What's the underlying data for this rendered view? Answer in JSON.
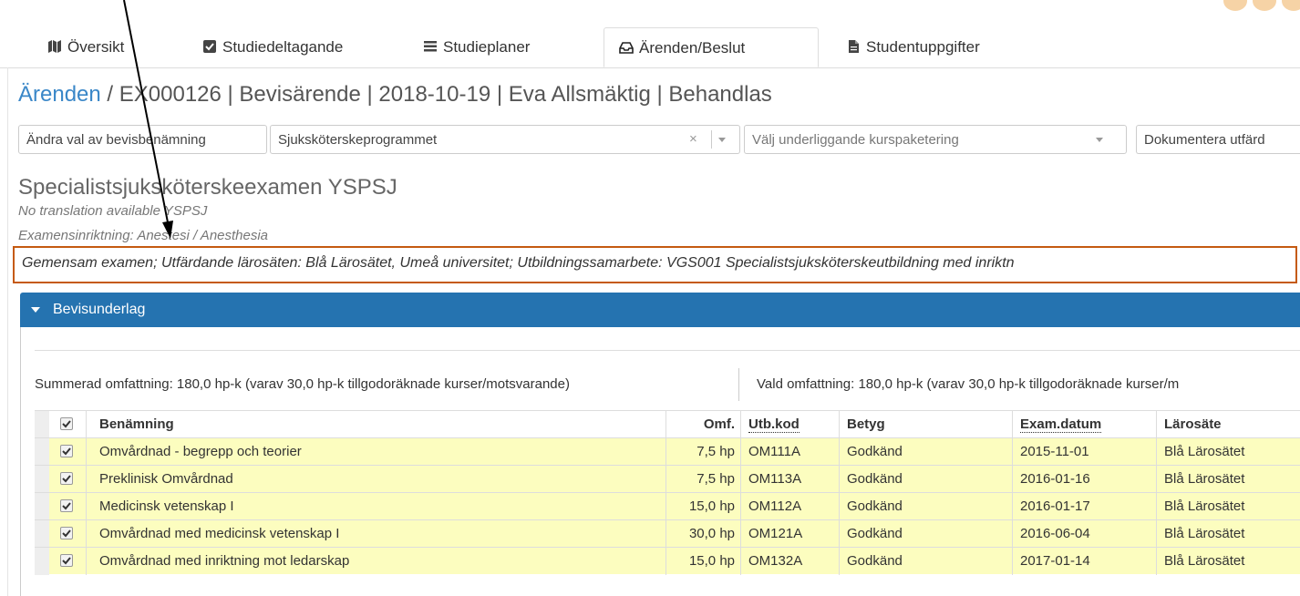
{
  "tabs": [
    {
      "label": "Översikt",
      "icon": "map-icon"
    },
    {
      "label": "Studiedeltagande",
      "icon": "check-square-icon"
    },
    {
      "label": "Studieplaner",
      "icon": "list-icon"
    },
    {
      "label": "Ärenden/Beslut",
      "icon": "inbox-icon",
      "active": true
    },
    {
      "label": "Studentuppgifter",
      "icon": "file-icon"
    }
  ],
  "title": {
    "link": "Ärenden",
    "rest": " / EX000126 | Bevisärende | 2018-10-19 | Eva Allsmäktig | Behandlas"
  },
  "toolbar": {
    "change_label": "Ändra val av bevisbenämning",
    "program_value": "Sjuksköterskeprogrammet",
    "clear_symbol": "×",
    "package_placeholder": "Välj underliggande kurspaketering",
    "document_label": "Dokumentera utfärd"
  },
  "exam": {
    "name": "Specialistsjuksköterskeexamen YSPSJ",
    "translation": "No translation available YSPSJ",
    "direction": "Examensinriktning: Anestesi / Anesthesia",
    "joint": "Gemensam examen; Utfärdande lärosäten: Blå Lärosätet, Umeå universitet; Utbildningssamarbete: VGS001 Specialistsjuksköterskeutbildning med inriktn"
  },
  "panel": {
    "heading": "Bevisunderlag",
    "summary_total": "Summerad omfattning: 180,0 hp-k (varav 30,0 hp-k tillgodoräknade kurser/motsvarande)",
    "summary_selected": "Vald omfattning: 180,0 hp-k (varav 30,0 hp-k tillgodoräknade kurser/m"
  },
  "table": {
    "headers": {
      "name": "Benämning",
      "scope": "Omf.",
      "code": "Utb.kod",
      "grade": "Betyg",
      "date": "Exam.datum",
      "institution": "Lärosäte"
    },
    "rows": [
      {
        "name": "Omvårdnad - begrepp och teorier",
        "scope": "7,5 hp",
        "code": "OM111A",
        "grade": "Godkänd",
        "date": "2015-11-01",
        "institution": "Blå Lärosätet"
      },
      {
        "name": "Preklinisk Omvårdnad",
        "scope": "7,5 hp",
        "code": "OM113A",
        "grade": "Godkänd",
        "date": "2016-01-16",
        "institution": "Blå Lärosätet"
      },
      {
        "name": "Medicinsk vetenskap I",
        "scope": "15,0 hp",
        "code": "OM112A",
        "grade": "Godkänd",
        "date": "2016-01-17",
        "institution": "Blå Lärosätet"
      },
      {
        "name": "Omvårdnad med medicinsk vetenskap I",
        "scope": "30,0 hp",
        "code": "OM121A",
        "grade": "Godkänd",
        "date": "2016-06-04",
        "institution": "Blå Lärosätet"
      },
      {
        "name": "Omvårdnad med inriktning mot ledarskap",
        "scope": "15,0 hp",
        "code": "OM132A",
        "grade": "Godkänd",
        "date": "2017-01-14",
        "institution": "Blå Lärosätet"
      }
    ]
  },
  "colors": {
    "link": "#3a87c8",
    "panel_header": "#2573b0",
    "highlight_border": "#c55a11",
    "row_highlight": "#fcfdbf"
  }
}
